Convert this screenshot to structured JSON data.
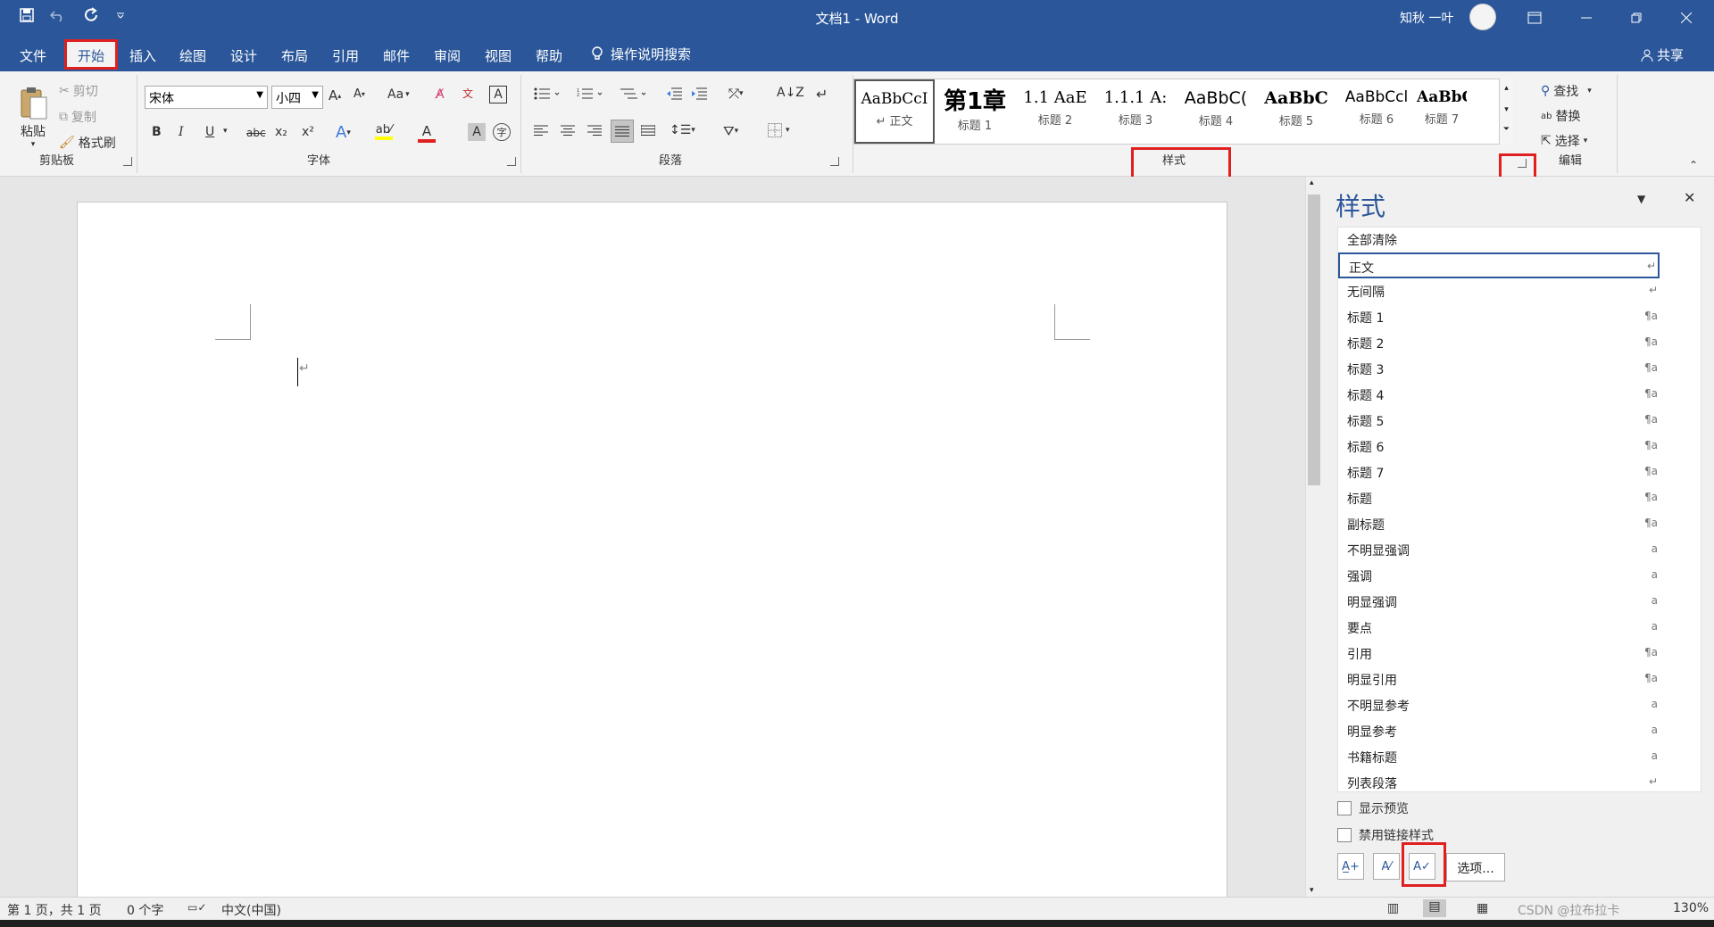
{
  "titlebar": {
    "doc_title": "文档1  -  Word",
    "user_name": "知秋 一叶"
  },
  "tabs": [
    "文件",
    "开始",
    "插入",
    "绘图",
    "设计",
    "布局",
    "引用",
    "邮件",
    "审阅",
    "视图",
    "帮助"
  ],
  "search_label": "操作说明搜索",
  "share_label": "共享",
  "clipboard": {
    "paste": "粘贴",
    "cut": "剪切",
    "copy": "复制",
    "format_painter": "格式刷",
    "group_label": "剪贴板"
  },
  "font": {
    "name_value": "宋体",
    "size_value": "小四",
    "change_case": "Aa",
    "bold": "B",
    "italic": "I",
    "underline": "U",
    "strike": "abc",
    "subscript": "x₂",
    "superscript": "x²",
    "group_label": "字体"
  },
  "paragraph": {
    "group_label": "段落"
  },
  "styles_gallery": {
    "items": [
      {
        "preview": "AaBbCcI",
        "name": "↵ 正文"
      },
      {
        "preview": "第1章",
        "name": "标题 1"
      },
      {
        "preview": "1.1  AaE",
        "name": "标题 2"
      },
      {
        "preview": "1.1.1  A:",
        "name": "标题 3"
      },
      {
        "preview": "AaBbC(",
        "name": "标题 4"
      },
      {
        "preview": "AaBbC",
        "name": "标题 5"
      },
      {
        "preview": "AaBbCcl",
        "name": "标题 6"
      },
      {
        "preview": "AaBbCcl",
        "name": "标题 7"
      }
    ],
    "group_label": "样式"
  },
  "editing": {
    "find": "查找",
    "replace": "替换",
    "select": "选择",
    "group_label": "编辑"
  },
  "styles_pane": {
    "title": "样式",
    "items": [
      {
        "name": "全部清除",
        "mark": ""
      },
      {
        "name": "正文",
        "mark": "↵"
      },
      {
        "name": "无间隔",
        "mark": "↵"
      },
      {
        "name": "标题 1",
        "mark": "¶a"
      },
      {
        "name": "标题 2",
        "mark": "¶a"
      },
      {
        "name": "标题 3",
        "mark": "¶a"
      },
      {
        "name": "标题 4",
        "mark": "¶a"
      },
      {
        "name": "标题 5",
        "mark": "¶a"
      },
      {
        "name": "标题 6",
        "mark": "¶a"
      },
      {
        "name": "标题 7",
        "mark": "¶a"
      },
      {
        "name": "标题",
        "mark": "¶a"
      },
      {
        "name": "副标题",
        "mark": "¶a"
      },
      {
        "name": "不明显强调",
        "mark": "a"
      },
      {
        "name": "强调",
        "mark": "a"
      },
      {
        "name": "明显强调",
        "mark": "a"
      },
      {
        "name": "要点",
        "mark": "a"
      },
      {
        "name": "引用",
        "mark": "¶a"
      },
      {
        "name": "明显引用",
        "mark": "¶a"
      },
      {
        "name": "不明显参考",
        "mark": "a"
      },
      {
        "name": "明显参考",
        "mark": "a"
      },
      {
        "name": "书籍标题",
        "mark": "a"
      },
      {
        "name": "列表段落",
        "mark": "↵"
      }
    ],
    "show_preview": "显示预览",
    "disable_linked": "禁用链接样式",
    "options_button": "选项..."
  },
  "statusbar": {
    "page": "第 1 页，共 1 页",
    "words": "0 个字",
    "language": "中文(中国)",
    "zoom": "130%",
    "watermark": "CSDN @拉布拉卡"
  },
  "colors": {
    "word_blue": "#2b579a",
    "highlight_red": "#e02020"
  }
}
